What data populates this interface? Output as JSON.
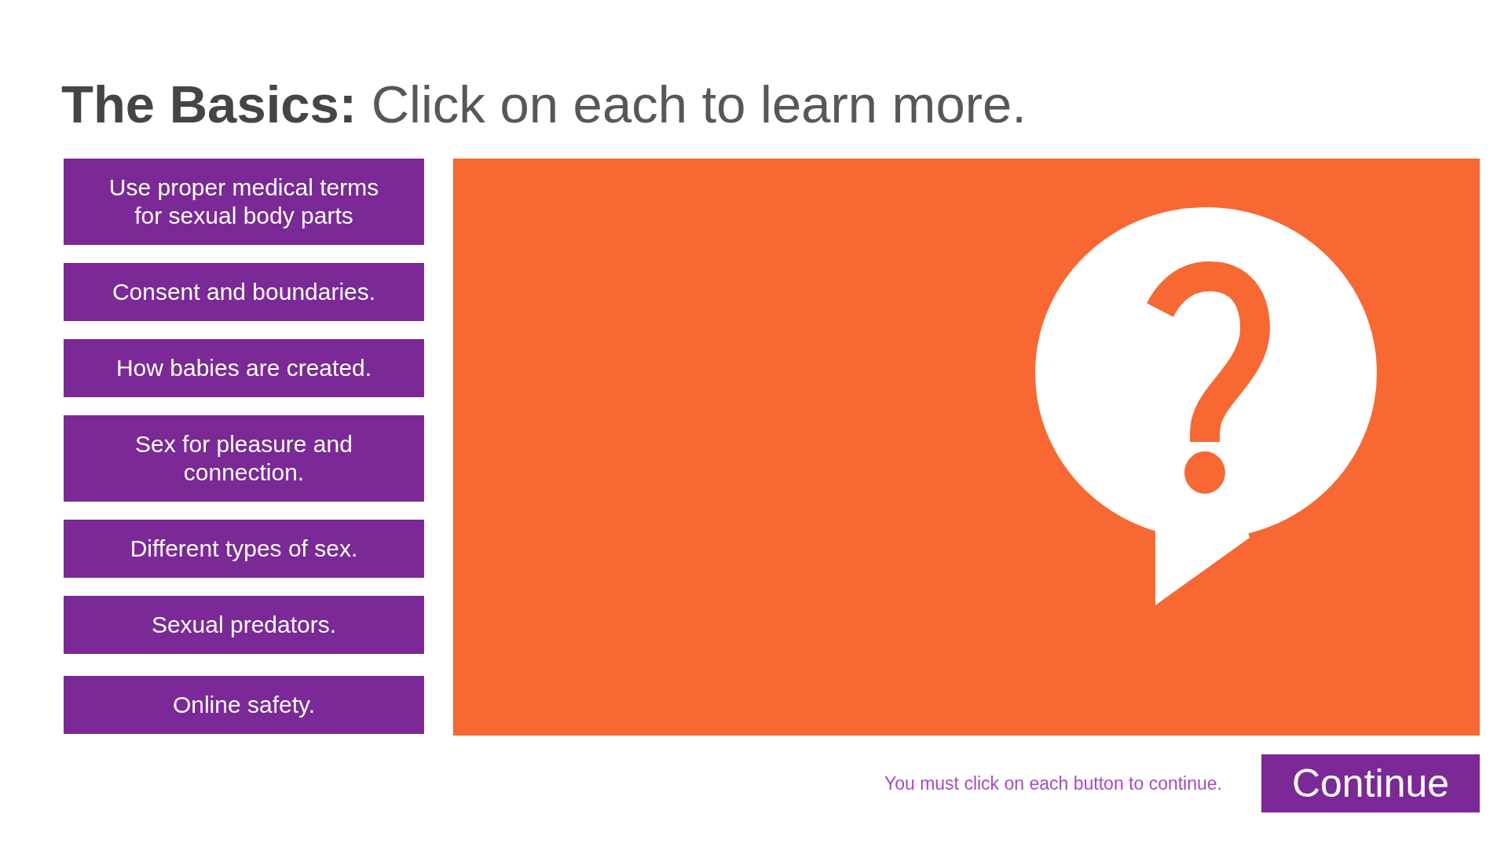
{
  "title": "**The Basics:** Click on each to learn more.",
  "topics": [
    {
      "label": "Use proper medical terms for sexual body parts"
    },
    {
      "label": "Consent and boundaries."
    },
    {
      "label": "How babies are created."
    },
    {
      "label": "Sex for pleasure and connection."
    },
    {
      "label": "Different types of sex."
    },
    {
      "label": "Sexual predators."
    },
    {
      "label": "Online safety."
    }
  ],
  "footer": {
    "hint": "You must click on each button to continue.",
    "continue_button": "Continue"
  }
}
